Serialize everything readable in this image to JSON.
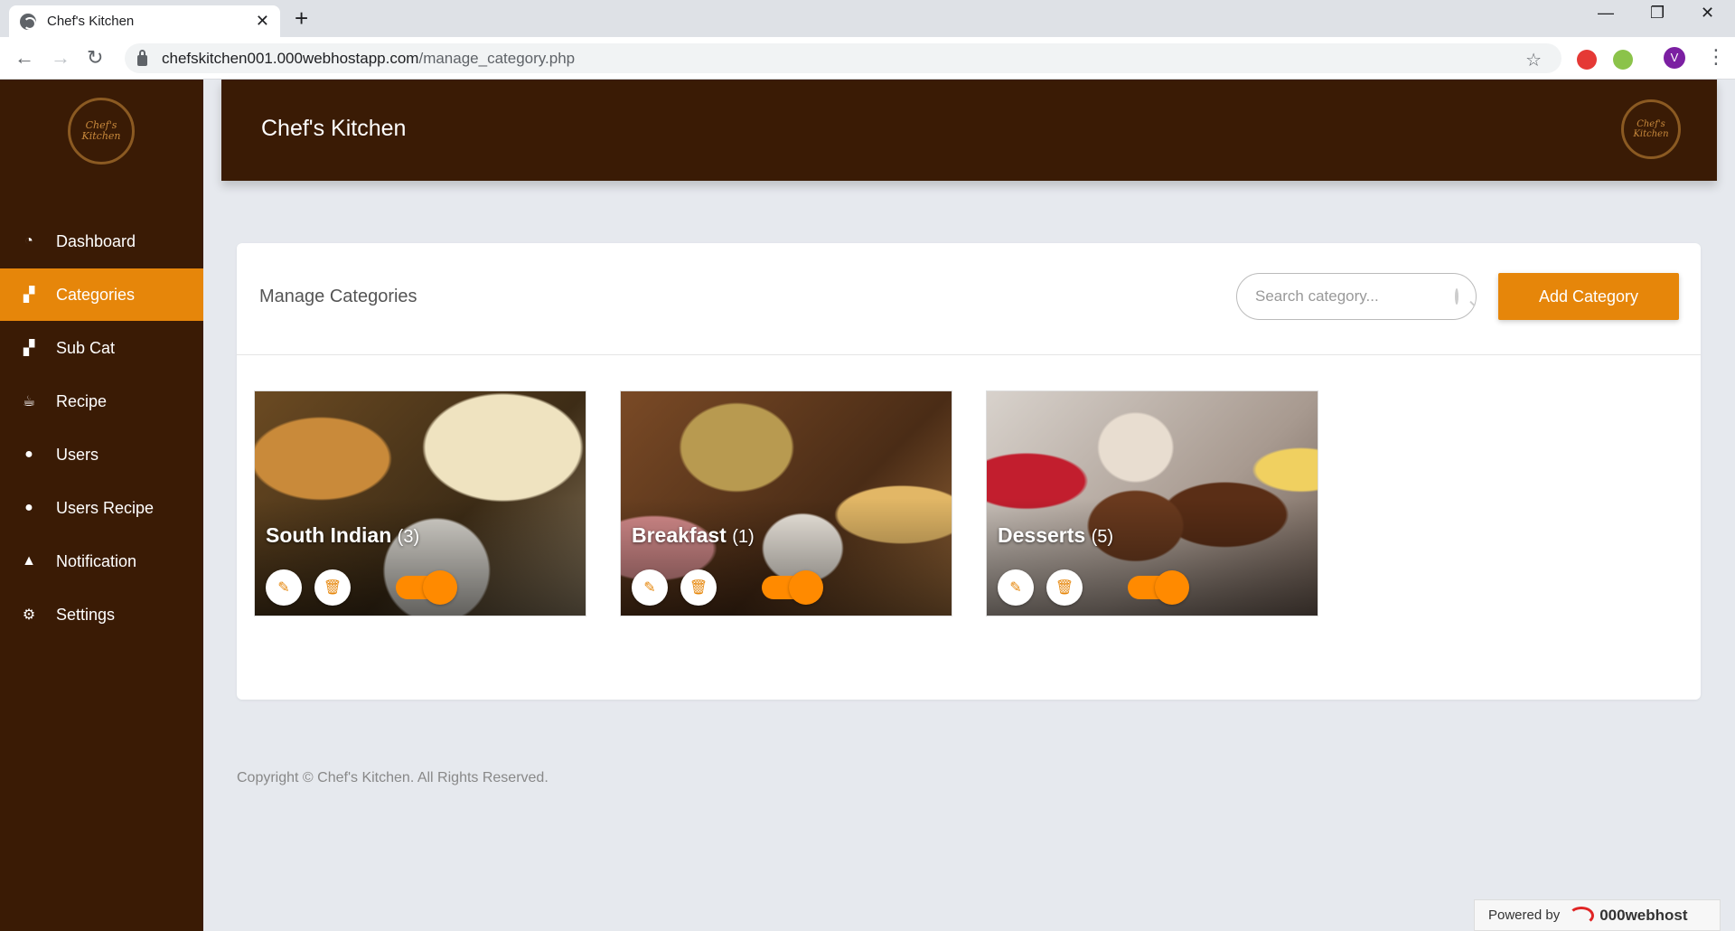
{
  "browser": {
    "tab_title": "Chef's Kitchen",
    "url_host": "chefskitchen001.000webhostapp.com",
    "url_path": "/manage_category.php",
    "profile_initial": "V"
  },
  "sidebar": {
    "logo_line1": "Chef's",
    "logo_line2": "Kitchen",
    "items": [
      {
        "label": "Dashboard",
        "icon": "dashboard-icon",
        "active": false
      },
      {
        "label": "Categories",
        "icon": "sitemap-icon",
        "active": true
      },
      {
        "label": "Sub Cat",
        "icon": "sitemap-icon",
        "active": false
      },
      {
        "label": "Recipe",
        "icon": "coffee-icon",
        "active": false
      },
      {
        "label": "Users",
        "icon": "users-icon",
        "active": false
      },
      {
        "label": "Users Recipe",
        "icon": "users-icon",
        "active": false
      },
      {
        "label": "Notification",
        "icon": "bell-icon",
        "active": false
      },
      {
        "label": "Settings",
        "icon": "gear-icon",
        "active": false
      }
    ]
  },
  "header": {
    "brand": "Chef's Kitchen"
  },
  "main": {
    "title": "Manage Categories",
    "search_placeholder": "Search category...",
    "add_button": "Add Category",
    "categories": [
      {
        "name": "South Indian",
        "count": "(3)",
        "enabled": true
      },
      {
        "name": "Breakfast",
        "count": "(1)",
        "enabled": true
      },
      {
        "name": "Desserts",
        "count": "(5)",
        "enabled": true
      }
    ]
  },
  "footer": {
    "copyright": "Copyright © Chef's Kitchen. All Rights Reserved.",
    "powered_by": "Powered by",
    "host_name": "000webhost"
  },
  "colors": {
    "brand_brown": "#3a1b05",
    "accent_orange": "#e6860a",
    "toggle_orange": "#ff8a00"
  }
}
